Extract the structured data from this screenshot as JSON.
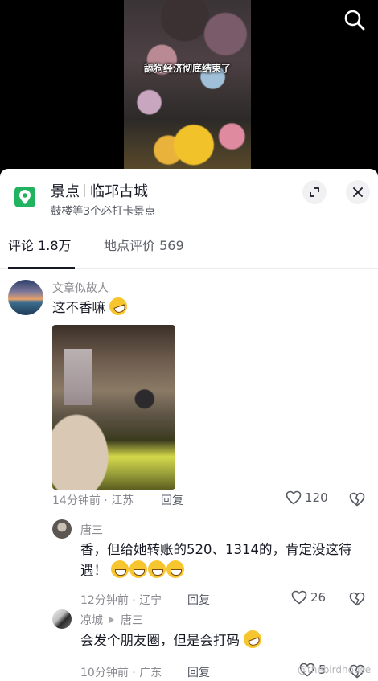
{
  "video": {
    "caption": "舔狗经济彻底结束了",
    "search_icon": "search-icon"
  },
  "poi": {
    "icon": "location-pin-icon",
    "category": "景点",
    "name": "临邛古城",
    "subtitle": "鼓楼等3个必打卡景点",
    "expand_icon": "expand-icon",
    "close_icon": "close-icon"
  },
  "tabs": [
    {
      "label": "评论 1.8万"
    },
    {
      "label": "地点评价 569"
    }
  ],
  "comments": [
    {
      "username": "文章似故人",
      "text": "这不香嘛",
      "time": "14分钟前",
      "location": "江苏",
      "reply_label": "回复",
      "likes": "120",
      "has_image": true
    },
    {
      "username": "唐三",
      "text": "香，但给她转账的520、1314的，肯定没这待遇！",
      "time": "12分钟前",
      "location": "辽宁",
      "reply_label": "回复",
      "likes": "26"
    },
    {
      "username": "凉城",
      "reply_to": "唐三",
      "text": "会发个朋友圈，但是会打码",
      "time": "10分钟前",
      "location": "广东",
      "reply_label": "回复",
      "likes": "5"
    }
  ],
  "watermark": "@thebirdhouse",
  "colors": {
    "accent_green": "#21b35f",
    "text_primary": "#161823",
    "text_secondary": "#8a8b91"
  }
}
